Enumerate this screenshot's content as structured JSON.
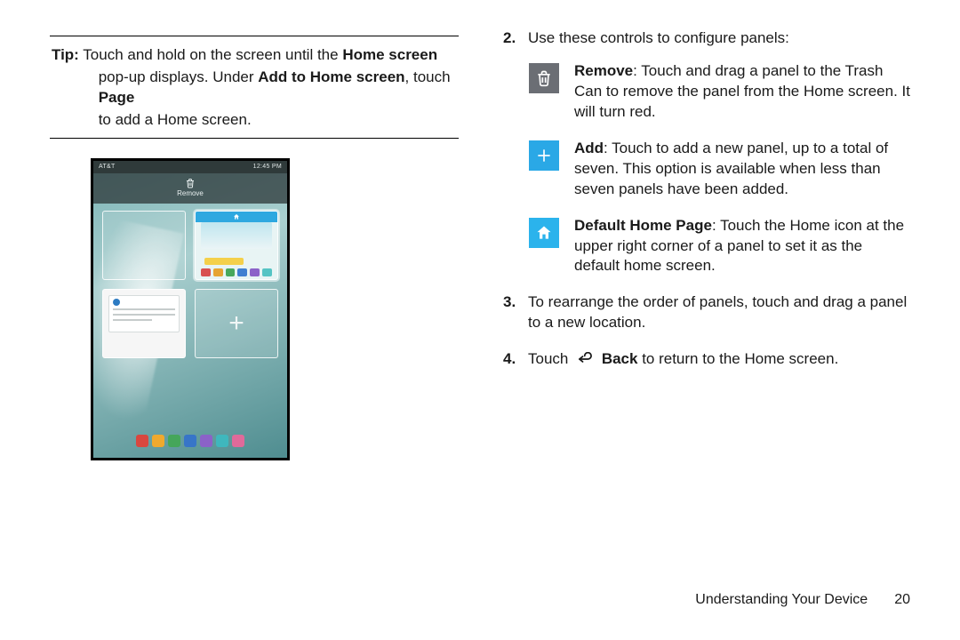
{
  "left": {
    "tip_label": "Tip:",
    "tip_1a": "Touch and hold on the screen until the ",
    "tip_1b": "Home screen",
    "tip_2a": "pop-up displays. Under ",
    "tip_2b": "Add to Home screen",
    "tip_2c": ", touch ",
    "tip_2d": "Page",
    "tip_3": "to add a Home screen."
  },
  "right": {
    "step2_num": "2.",
    "step2_text": "Use these controls to configure panels:",
    "controls": {
      "remove_label": "Remove",
      "remove_text": ": Touch and drag a panel to the Trash Can to remove the panel from the Home screen. It will turn red.",
      "add_label": "Add",
      "add_text": ": Touch to add a new panel, up to a total of seven. This option is available when less than seven panels have been added.",
      "home_label": "Default Home Page",
      "home_text": ": Touch the Home icon at the upper right corner of a panel to set it as the default home screen."
    },
    "step3_num": "3.",
    "step3_text": "To rearrange the order of panels, touch and drag a panel to a new location.",
    "step4_num": "4.",
    "step4_a": "Touch ",
    "step4_b": "Back",
    "step4_c": " to return to the Home screen."
  },
  "device": {
    "carrier": "AT&T",
    "time": "12:45 PM",
    "remove_label": "Remove"
  },
  "footer": {
    "section": "Understanding Your Device",
    "page": "20"
  }
}
